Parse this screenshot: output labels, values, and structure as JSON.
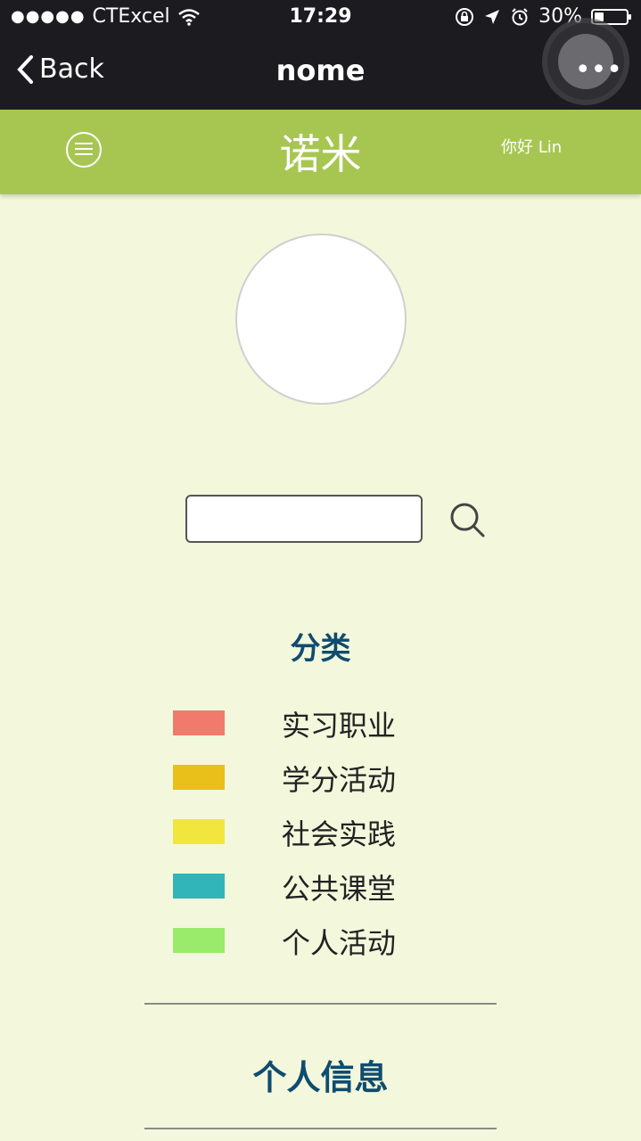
{
  "status_bar": {
    "carrier": "CTExcel",
    "signal": "●●●●●",
    "time": "17:29",
    "battery": "30%"
  },
  "nav_bar": {
    "back_label": "Back",
    "title": "nome"
  },
  "header": {
    "title": "诺米",
    "greeting": "你好 Lin"
  },
  "search": {
    "value": "",
    "placeholder": ""
  },
  "category": {
    "title": "分类",
    "items": [
      {
        "label": "实习职业",
        "color": "#f07b6c"
      },
      {
        "label": "学分活动",
        "color": "#e9bf1a"
      },
      {
        "label": "社会实践",
        "color": "#f1e63e"
      },
      {
        "label": "公共课堂",
        "color": "#32b5b8"
      },
      {
        "label": "个人活动",
        "color": "#9aea6c"
      }
    ]
  },
  "personal": {
    "title": "个人信息"
  },
  "colors": {
    "header_bg": "#a7c651",
    "page_bg": "#f3f8dc",
    "title_text": "#0f4c6f"
  }
}
